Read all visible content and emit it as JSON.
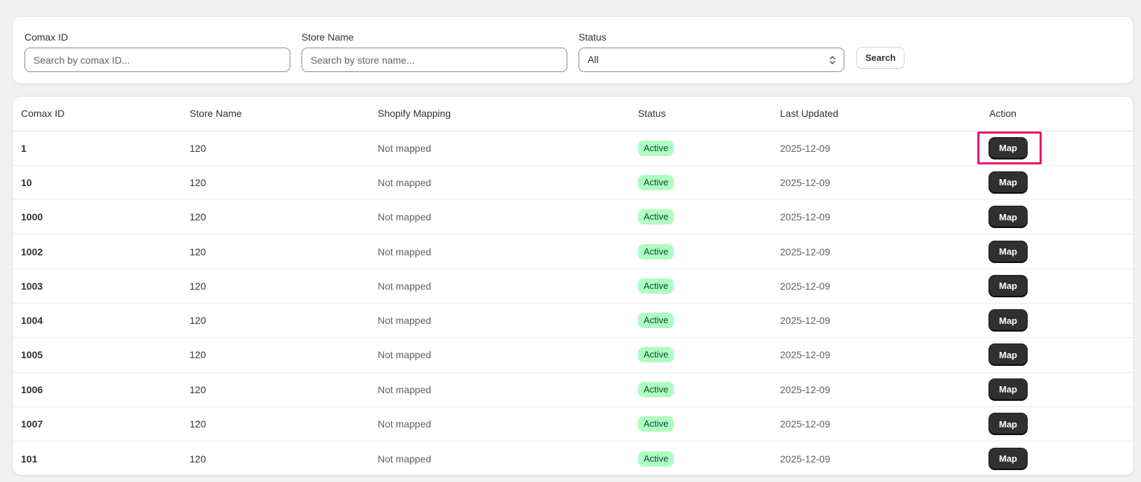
{
  "filters": {
    "comax_id": {
      "label": "Comax ID",
      "placeholder": "Search by comax ID..."
    },
    "store_name": {
      "label": "Store Name",
      "placeholder": "Search by store name..."
    },
    "status": {
      "label": "Status",
      "value": "All"
    },
    "search_label": "Search"
  },
  "table": {
    "headers": [
      "Comax ID",
      "Store Name",
      "Shopify Mapping",
      "Status",
      "Last Updated",
      "Action"
    ],
    "rows": [
      {
        "comax_id": "1",
        "store_name": "120",
        "mapping": "Not mapped",
        "status": "Active",
        "updated": "2025-12-09",
        "action": "Map"
      },
      {
        "comax_id": "10",
        "store_name": "120",
        "mapping": "Not mapped",
        "status": "Active",
        "updated": "2025-12-09",
        "action": "Map"
      },
      {
        "comax_id": "1000",
        "store_name": "120",
        "mapping": "Not mapped",
        "status": "Active",
        "updated": "2025-12-09",
        "action": "Map"
      },
      {
        "comax_id": "1002",
        "store_name": "120",
        "mapping": "Not mapped",
        "status": "Active",
        "updated": "2025-12-09",
        "action": "Map"
      },
      {
        "comax_id": "1003",
        "store_name": "120",
        "mapping": "Not mapped",
        "status": "Active",
        "updated": "2025-12-09",
        "action": "Map"
      },
      {
        "comax_id": "1004",
        "store_name": "120",
        "mapping": "Not mapped",
        "status": "Active",
        "updated": "2025-12-09",
        "action": "Map"
      },
      {
        "comax_id": "1005",
        "store_name": "120",
        "mapping": "Not mapped",
        "status": "Active",
        "updated": "2025-12-09",
        "action": "Map"
      },
      {
        "comax_id": "1006",
        "store_name": "120",
        "mapping": "Not mapped",
        "status": "Active",
        "updated": "2025-12-09",
        "action": "Map"
      },
      {
        "comax_id": "1007",
        "store_name": "120",
        "mapping": "Not mapped",
        "status": "Active",
        "updated": "2025-12-09",
        "action": "Map"
      },
      {
        "comax_id": "101",
        "store_name": "120",
        "mapping": "Not mapped",
        "status": "Active",
        "updated": "2025-12-09",
        "action": "Map"
      }
    ]
  },
  "colors": {
    "highlight": "#e8176b",
    "badge_bg": "#affebf",
    "button_dark": "#303030"
  }
}
